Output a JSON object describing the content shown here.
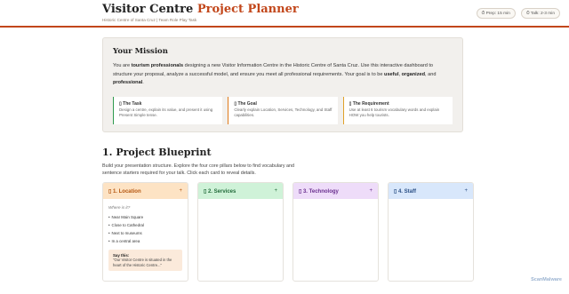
{
  "header": {
    "title_main": "Visitor Centre ",
    "title_accent": "Project Planner",
    "subtitle": "Historic Centre of Santa Cruz | Team Role Play Task",
    "badges": [
      "⏱ Prep: 15 min",
      "⏱ Talk: 2-3 min"
    ]
  },
  "mission": {
    "heading": "Your Mission",
    "text_1": "You are ",
    "bold_1": "tourism professionals",
    "text_2": " designing a new Visitor Information Centre in the Historic Centre of Santa Cruz. Use this interactive dashboard to structure your proposal, analyze a successful model, and ensure you meet all professional requirements. Your goal is to be ",
    "bold_2": "useful",
    "text_3": ", ",
    "bold_3": "organized",
    "text_4": ", and ",
    "bold_4": "professional",
    "text_5": ".",
    "cards": [
      {
        "title": "▯ The Task",
        "body": "Design a centre, explain its value, and present it using Present Simple tense."
      },
      {
        "title": "▯ The Goal",
        "body": "Clearly explain Location, Services, Technology, and Staff capabilities."
      },
      {
        "title": "▯ The Requirement",
        "body": "Use at least 6 tourism vocabulary words and explain HOW you help tourists."
      }
    ]
  },
  "blueprint": {
    "heading": "1. Project Blueprint",
    "intro": "Build your presentation structure. Explore the four core pillars below to find vocabulary and sentence starters required for your talk. Click each card to reveal details.",
    "pillars": [
      {
        "label": "▯ 1. Location",
        "toggle": "+"
      },
      {
        "label": "▯ 2. Services",
        "toggle": "+"
      },
      {
        "label": "▯ 3. Technology",
        "toggle": "+"
      },
      {
        "label": "▯ 4. Staff",
        "toggle": "+"
      }
    ],
    "location_detail": {
      "question": "Where is it?",
      "vocab": [
        "Near Main Square",
        "Close to Cathedral",
        "Next to museums",
        "In a central area"
      ],
      "say_label": "Say this:",
      "say_text": "\"Our Visitor Centre is situated in the heart of the Historic Centre...\""
    }
  },
  "watermark": "ScanMalware"
}
